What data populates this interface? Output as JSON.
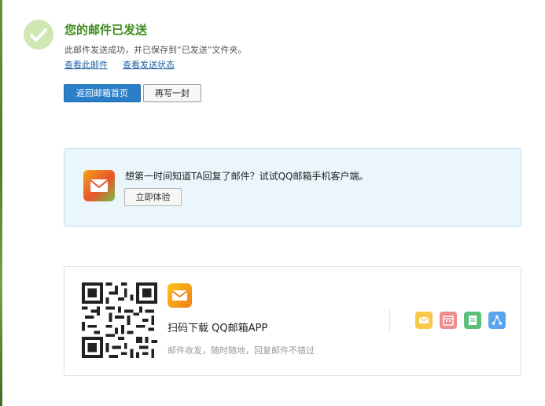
{
  "header": {
    "title": "您的邮件已发送",
    "description": "此邮件发送成功，并已保存到“已发送”文件夹。",
    "links": [
      "查看此邮件",
      "查看发送状态"
    ]
  },
  "actions": {
    "back_label": "返回邮箱首页",
    "rewrite_label": "再写一封"
  },
  "promo": {
    "text": "想第一时间知道TA回复了邮件？试试QQ邮箱手机客户端。",
    "button_label": "立即体验"
  },
  "app": {
    "title": "扫码下载 QQ邮箱APP",
    "subtitle": "邮件收发，随时随地，回复邮件不错过",
    "feature_icons": [
      {
        "name": "mail-icon",
        "color": "#f7c948"
      },
      {
        "name": "calendar-icon",
        "color": "#f08c8c"
      },
      {
        "name": "note-icon",
        "color": "#5bbf7a"
      },
      {
        "name": "share-icon",
        "color": "#5aa4ee"
      }
    ]
  },
  "colors": {
    "success_green": "#3d8c1c",
    "primary_blue": "#2a7fc8",
    "link_blue": "#1f5f9e",
    "promo_bg": "#eaf6fb"
  }
}
